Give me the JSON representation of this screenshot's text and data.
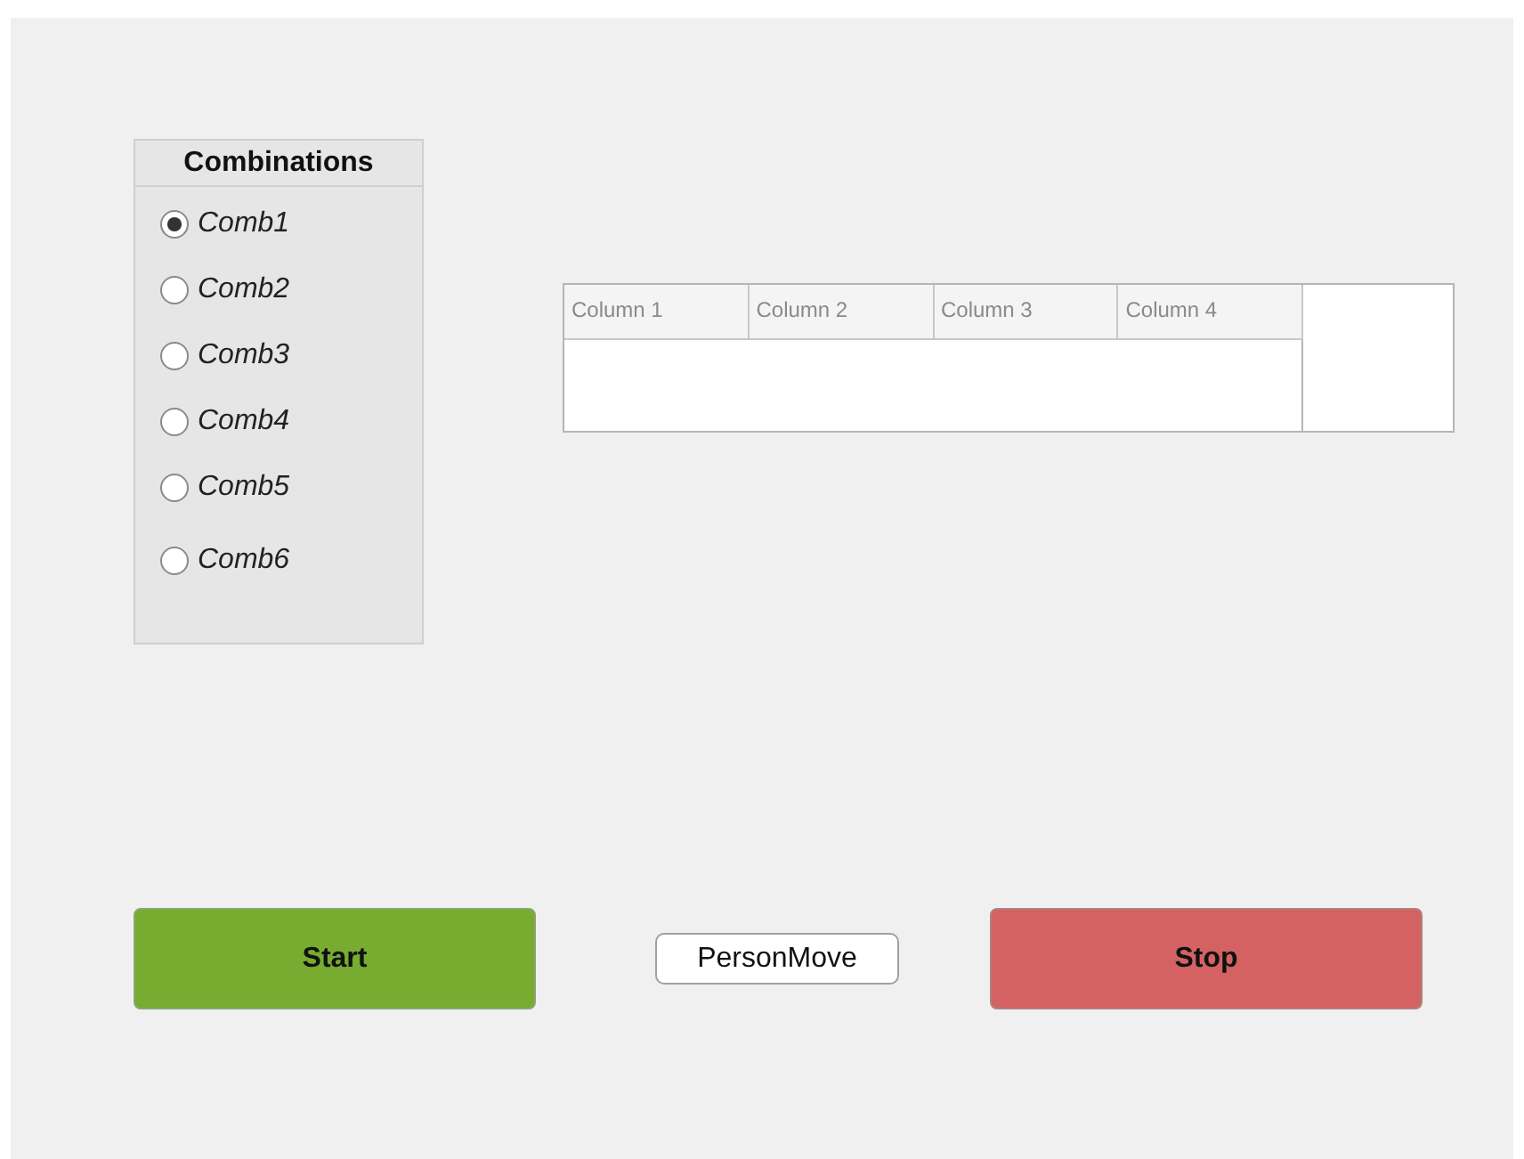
{
  "radio_panel": {
    "title": "Combinations",
    "options": [
      {
        "label": "Comb1",
        "selected": true
      },
      {
        "label": "Comb2",
        "selected": false
      },
      {
        "label": "Comb3",
        "selected": false
      },
      {
        "label": "Comb4",
        "selected": false
      },
      {
        "label": "Comb5",
        "selected": false
      },
      {
        "label": "Comb6",
        "selected": false
      }
    ]
  },
  "table": {
    "columns": [
      "Column 1",
      "Column 2",
      "Column 3",
      "Column 4"
    ]
  },
  "buttons": [
    {
      "label": "Start",
      "kind": "start"
    },
    {
      "label": "PersonMove",
      "kind": "plain"
    },
    {
      "label": "Stop",
      "kind": "stop"
    }
  ]
}
